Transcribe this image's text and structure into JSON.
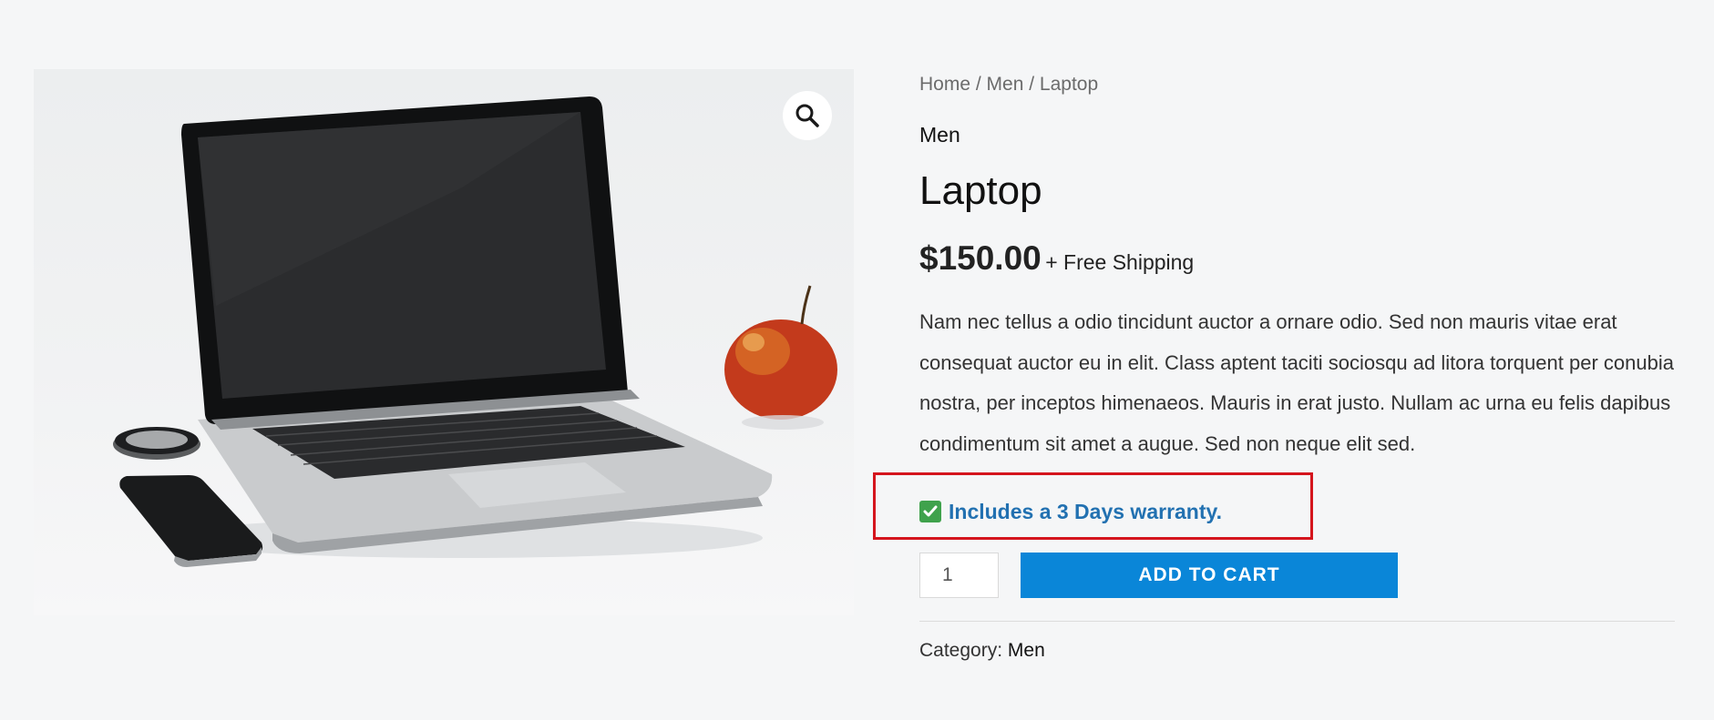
{
  "breadcrumb": {
    "home": "Home",
    "sep1": " / ",
    "category": "Men",
    "sep2": " / ",
    "current": "Laptop"
  },
  "product": {
    "category_label": "Men",
    "title": "Laptop",
    "price": "$150.00",
    "shipping": "+ Free Shipping",
    "description": "Nam nec tellus a odio tincidunt auctor a ornare odio. Sed non mauris vitae erat consequat auctor eu in elit. Class aptent taciti sociosqu ad litora torquent per conubia nostra, per inceptos himenaeos. Mauris in erat justo. Nullam ac urna eu felis dapibus condimentum sit amet a augue. Sed non neque elit sed.",
    "warranty": "Includes a 3 Days warranty.",
    "quantity": "1",
    "add_to_cart": "ADD TO CART",
    "meta_label": "Category:",
    "meta_value": "Men"
  },
  "icons": {
    "zoom": "magnifier-icon",
    "warranty": "check-mark-icon"
  },
  "colors": {
    "accent_button": "#0a86d8",
    "warranty_text": "#2271b1",
    "highlight_border": "#d4151d",
    "check_green": "#3fa24c"
  }
}
